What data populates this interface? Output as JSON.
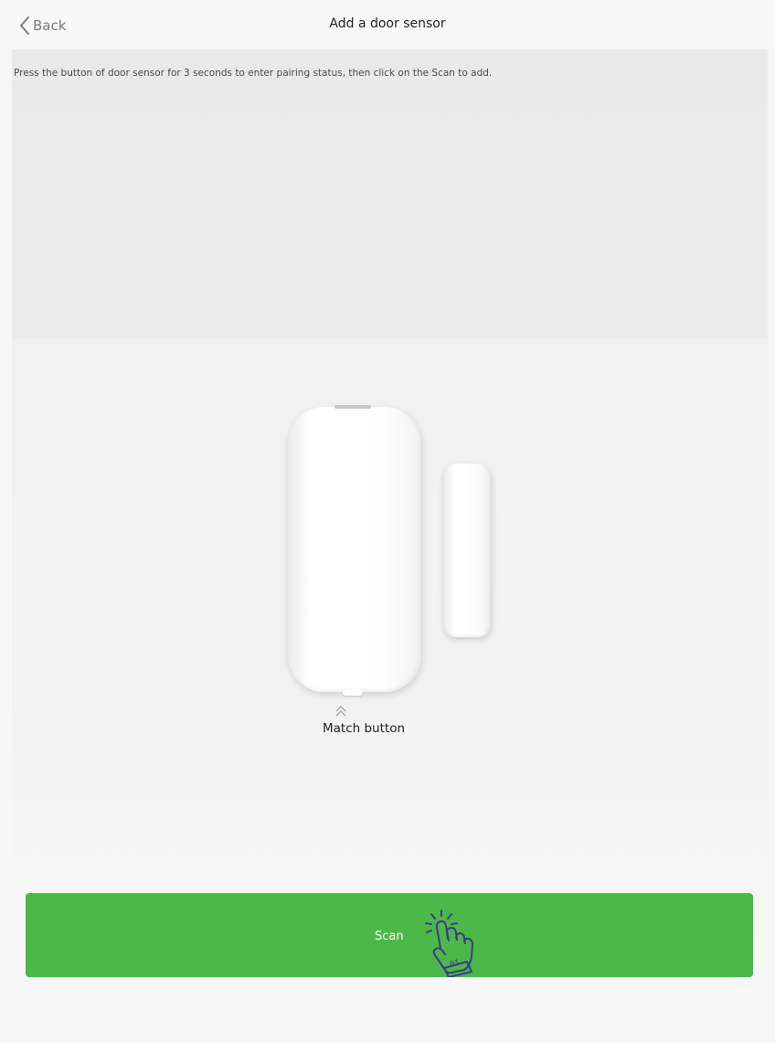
{
  "header": {
    "back_label": "Back",
    "title": "Add a door sensor"
  },
  "main": {
    "instruction": "Press the button of door sensor for 3 seconds to enter pairing status, then click on the Scan to add.",
    "match_label": "Match button"
  },
  "actions": {
    "scan_label": "Scan"
  },
  "icons": {
    "back": "chevron-left-icon",
    "match_indicator": "double-chevron-up-icon",
    "scan_hint": "pointing-hand-icon"
  },
  "colors": {
    "scan_button": "#4cb847",
    "hand_stroke": "#3e3a8c"
  }
}
